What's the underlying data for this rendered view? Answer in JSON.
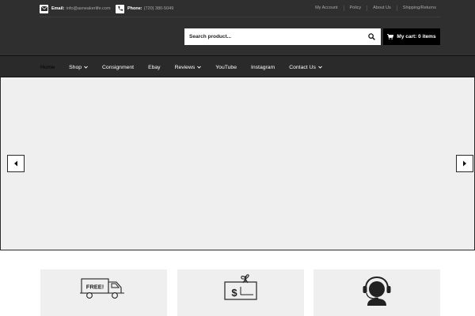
{
  "header": {
    "email": {
      "label": "Email:",
      "value": "info@asneakerlife.com"
    },
    "phone": {
      "label": "Phone:",
      "value": "(720) 380-5049"
    },
    "top_links": [
      "My Account",
      "Policy",
      "About Us",
      "Shipping/Returns"
    ],
    "search": {
      "placeholder": "Search product..."
    },
    "cart": {
      "label": "My cart: 0 items"
    }
  },
  "nav": {
    "items": [
      {
        "label": "Home"
      },
      {
        "label": "Shop"
      },
      {
        "label": "Consignment"
      },
      {
        "label": "Ebay"
      },
      {
        "label": "Reviews"
      },
      {
        "label": "YouTube"
      },
      {
        "label": "Instagram"
      },
      {
        "label": "Contact Us"
      }
    ]
  },
  "features": [
    {
      "icon": "free-shipping-truck-icon",
      "text": "FREE!"
    },
    {
      "icon": "gift-card-icon",
      "text": "$"
    },
    {
      "icon": "customer-support-headset-icon"
    }
  ],
  "colors": {
    "header_bg": "#2f2f2f",
    "nav_bg": "#2a2a2a",
    "slider_bg": "#efefef",
    "cart_bg": "#000000"
  }
}
